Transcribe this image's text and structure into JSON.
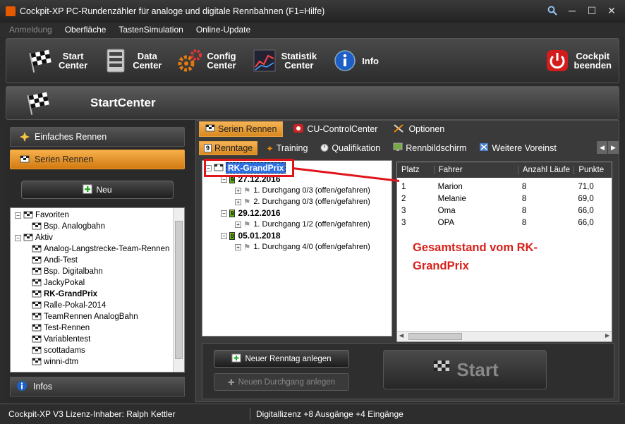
{
  "window": {
    "title": "Cockpit-XP PC-Rundenzähler für analoge und digitale Rennbahnen (F1=Hilfe)",
    "buttons": [
      "search",
      "minimize",
      "maximize",
      "close"
    ]
  },
  "menu": [
    {
      "label": "Anmeldung",
      "disabled": true
    },
    {
      "label": "Oberfläche"
    },
    {
      "label": "TastenSimulation"
    },
    {
      "label": "Online-Update"
    }
  ],
  "toolbar": {
    "start": "Start\nCenter",
    "data": "Data\nCenter",
    "config": "Config\nCenter",
    "statistik": "Statistik\nCenter",
    "info": "Info",
    "exit": "Cockpit\nbeenden"
  },
  "header": {
    "title": "StartCenter"
  },
  "left": {
    "einfaches": "Einfaches Rennen",
    "serien": "Serien Rennen",
    "neu": "Neu",
    "infos": "Infos",
    "tree": [
      {
        "label": "Favoriten",
        "level": 0,
        "bold": false
      },
      {
        "label": "Bsp. Analogbahn",
        "level": 1,
        "bold": false
      },
      {
        "label": "Aktiv",
        "level": 0,
        "bold": false
      },
      {
        "label": "Analog-Langstrecke-Team-Rennen",
        "level": 1,
        "bold": false
      },
      {
        "label": "Andi-Test",
        "level": 1,
        "bold": false
      },
      {
        "label": "Bsp. Digitalbahn",
        "level": 1,
        "bold": false
      },
      {
        "label": "JackyPokal",
        "level": 1,
        "bold": false
      },
      {
        "label": "RK-GrandPrix",
        "level": 1,
        "bold": true
      },
      {
        "label": "Ralle-Pokal-2014",
        "level": 1,
        "bold": false
      },
      {
        "label": "TeamRennen AnalogBahn",
        "level": 1,
        "bold": false
      },
      {
        "label": "Test-Rennen",
        "level": 1,
        "bold": false
      },
      {
        "label": "Variablentest",
        "level": 1,
        "bold": false
      },
      {
        "label": "scottadams",
        "level": 1,
        "bold": false
      },
      {
        "label": "winni-dtm",
        "level": 1,
        "bold": false
      }
    ]
  },
  "tabs1": [
    "Serien Rennen",
    "CU-ControlCenter",
    "Optionen"
  ],
  "tabs2": [
    "Renntage",
    "Training",
    "Qualifikation",
    "Rennbildschirm",
    "Weitere Voreinst"
  ],
  "tab2_badge": "9",
  "event_tree": {
    "root": "RK-GrandPrix",
    "days": [
      {
        "date": "27.12.2016",
        "runs": [
          "1. Durchgang 0/3 (offen/gefahren)",
          "2. Durchgang 0/3 (offen/gefahren)"
        ]
      },
      {
        "date": "29.12.2016",
        "runs": [
          "1. Durchgang 1/2 (offen/gefahren)"
        ]
      },
      {
        "date": "05.01.2018",
        "runs": [
          "1. Durchgang 4/0 (offen/gefahren)"
        ]
      }
    ],
    "badge": "9"
  },
  "standings": {
    "headers": [
      "Platz",
      "Fahrer",
      "Anzahl Läufe",
      "Punkte"
    ],
    "rows": [
      [
        "1",
        "Marion",
        "8",
        "71,0"
      ],
      [
        "2",
        "Melanie",
        "8",
        "69,0"
      ],
      [
        "3",
        "Oma",
        "8",
        "66,0"
      ],
      [
        "3",
        "OPA",
        "8",
        "66,0"
      ]
    ]
  },
  "annotation": "Gesamtstand vom RK-GrandPrix",
  "actions": {
    "neuer_renntag": "Neuer Renntag anlegen",
    "neuer_durchgang": "Neuen Durchgang anlegen",
    "start": "Start"
  },
  "status": {
    "left": "Cockpit-XP V3 Lizenz-Inhaber: Ralph Kettler",
    "right": "Digitallizenz  +8 Ausgänge +4 Eingänge"
  },
  "colors": {
    "accent": "#e9961f",
    "annotation": "#d8201a"
  }
}
